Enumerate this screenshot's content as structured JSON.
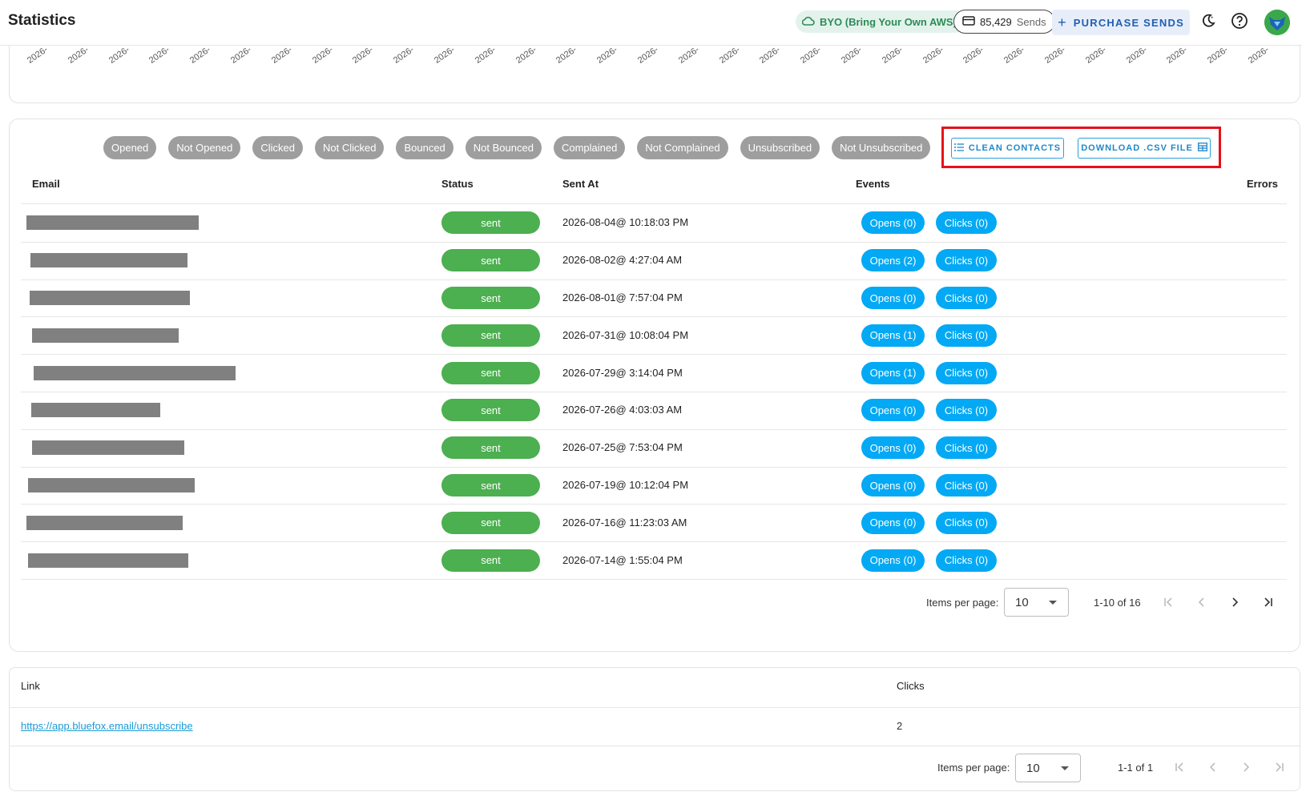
{
  "header": {
    "title": "Statistics",
    "byo_label": "BYO (Bring Your Own AWS)",
    "sends_count": "85,429",
    "sends_label": "Sends",
    "purchase_label": "PURCHASE SENDS"
  },
  "chart_axis": {
    "tick_label": "2026-",
    "tick_count": 31
  },
  "filters": [
    "Opened",
    "Not Opened",
    "Clicked",
    "Not Clicked",
    "Bounced",
    "Not Bounced",
    "Complained",
    "Not Complained",
    "Unsubscribed",
    "Not Unsubscribed"
  ],
  "actions": {
    "clean_contacts": "CLEAN CONTACTS",
    "download_csv": "DOWNLOAD .CSV FILE"
  },
  "table": {
    "columns": {
      "email": "Email",
      "status": "Status",
      "sent_at": "Sent At",
      "events": "Events",
      "errors": "Errors"
    },
    "rows": [
      {
        "status": "sent",
        "sent_at": "2026-08-04@ 10:18:03 PM",
        "opens": "Opens (0)",
        "clicks": "Clicks (0)"
      },
      {
        "status": "sent",
        "sent_at": "2026-08-02@ 4:27:04 AM",
        "opens": "Opens (2)",
        "clicks": "Clicks (0)"
      },
      {
        "status": "sent",
        "sent_at": "2026-08-01@ 7:57:04 PM",
        "opens": "Opens (0)",
        "clicks": "Clicks (0)"
      },
      {
        "status": "sent",
        "sent_at": "2026-07-31@ 10:08:04 PM",
        "opens": "Opens (1)",
        "clicks": "Clicks (0)"
      },
      {
        "status": "sent",
        "sent_at": "2026-07-29@ 3:14:04 PM",
        "opens": "Opens (1)",
        "clicks": "Clicks (0)"
      },
      {
        "status": "sent",
        "sent_at": "2026-07-26@ 4:03:03 AM",
        "opens": "Opens (0)",
        "clicks": "Clicks (0)"
      },
      {
        "status": "sent",
        "sent_at": "2026-07-25@ 7:53:04 PM",
        "opens": "Opens (0)",
        "clicks": "Clicks (0)"
      },
      {
        "status": "sent",
        "sent_at": "2026-07-19@ 10:12:04 PM",
        "opens": "Opens (0)",
        "clicks": "Clicks (0)"
      },
      {
        "status": "sent",
        "sent_at": "2026-07-16@ 11:23:03 AM",
        "opens": "Opens (0)",
        "clicks": "Clicks (0)"
      },
      {
        "status": "sent",
        "sent_at": "2026-07-14@ 1:55:04 PM",
        "opens": "Opens (0)",
        "clicks": "Clicks (0)"
      }
    ],
    "pagination": {
      "items_per_page_label": "Items per page:",
      "items_per_page": "10",
      "range": "1-10 of 16"
    }
  },
  "links_table": {
    "columns": {
      "link": "Link",
      "clicks": "Clicks"
    },
    "rows": [
      {
        "link": "https://app.bluefox.email/unsubscribe",
        "clicks": "2"
      }
    ],
    "pagination": {
      "items_per_page_label": "Items per page:",
      "items_per_page": "10",
      "range": "1-1 of 1"
    }
  },
  "colors": {
    "status_sent": "#4caf50",
    "event_pill": "#03a9f4",
    "filter_chip": "#9e9e9e",
    "highlight": "#e8101a",
    "action_outline": "#29a0dc"
  }
}
